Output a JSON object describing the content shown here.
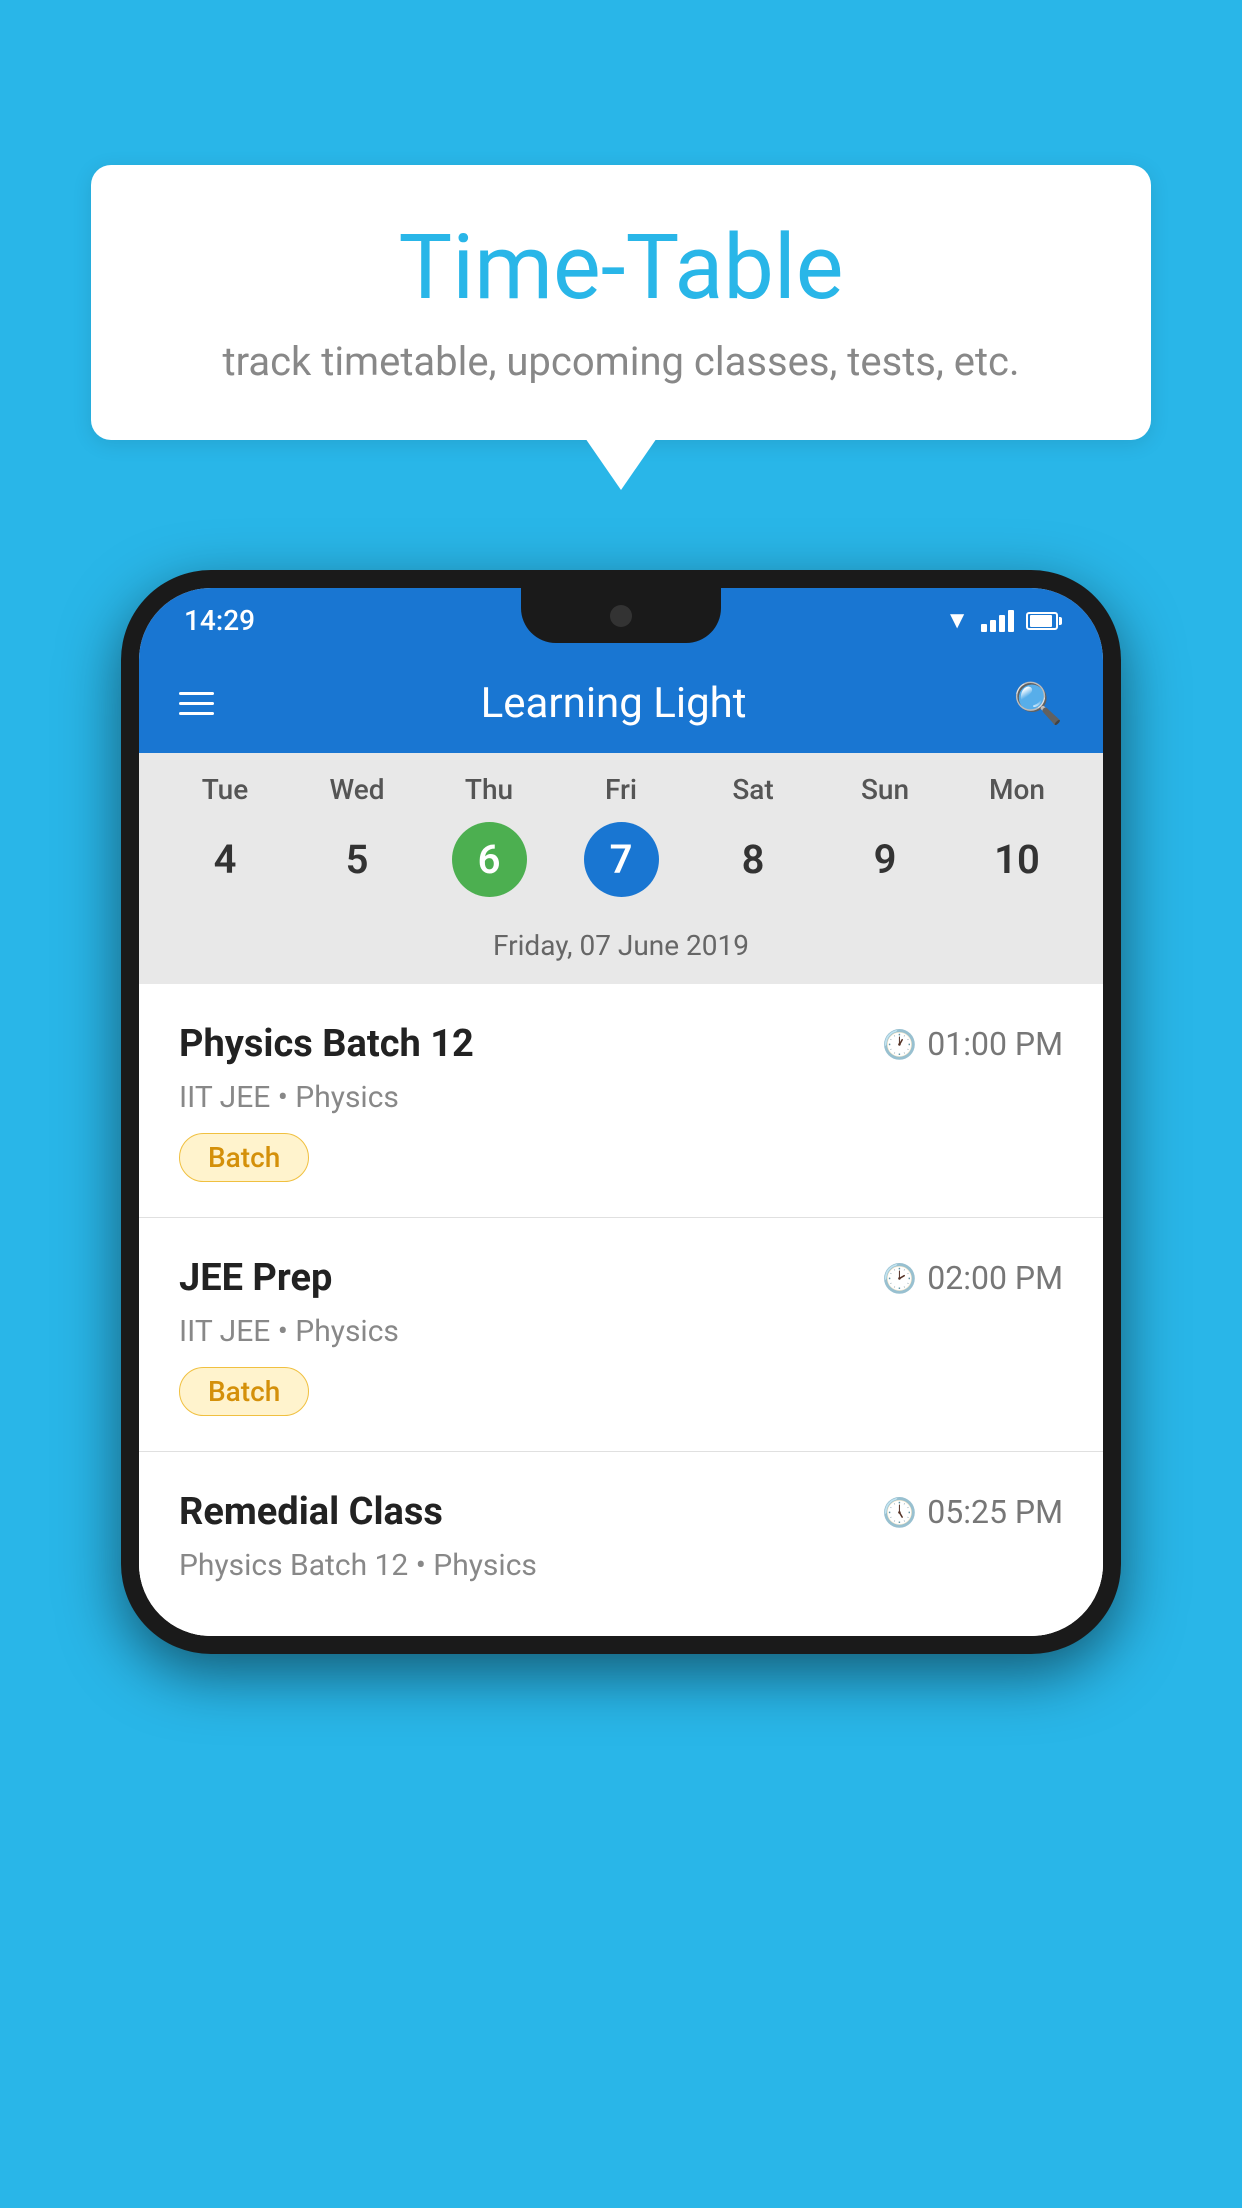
{
  "page": {
    "background_color": "#29B6E8"
  },
  "bubble": {
    "title": "Time-Table",
    "subtitle": "track timetable, upcoming classes, tests, etc."
  },
  "phone": {
    "status_bar": {
      "time": "14:29"
    },
    "app_bar": {
      "title": "Learning Light"
    },
    "calendar": {
      "days": [
        "Tue",
        "Wed",
        "Thu",
        "Fri",
        "Sat",
        "Sun",
        "Mon"
      ],
      "dates": [
        "4",
        "5",
        "6",
        "7",
        "8",
        "9",
        "10"
      ],
      "today_index": 2,
      "selected_index": 3,
      "selected_date_label": "Friday, 07 June 2019"
    },
    "schedule": [
      {
        "title": "Physics Batch 12",
        "time": "01:00 PM",
        "sub": "IIT JEE • Physics",
        "badge": "Batch"
      },
      {
        "title": "JEE Prep",
        "time": "02:00 PM",
        "sub": "IIT JEE • Physics",
        "badge": "Batch"
      },
      {
        "title": "Remedial Class",
        "time": "05:25 PM",
        "sub": "Physics Batch 12 • Physics",
        "badge": null
      }
    ]
  }
}
